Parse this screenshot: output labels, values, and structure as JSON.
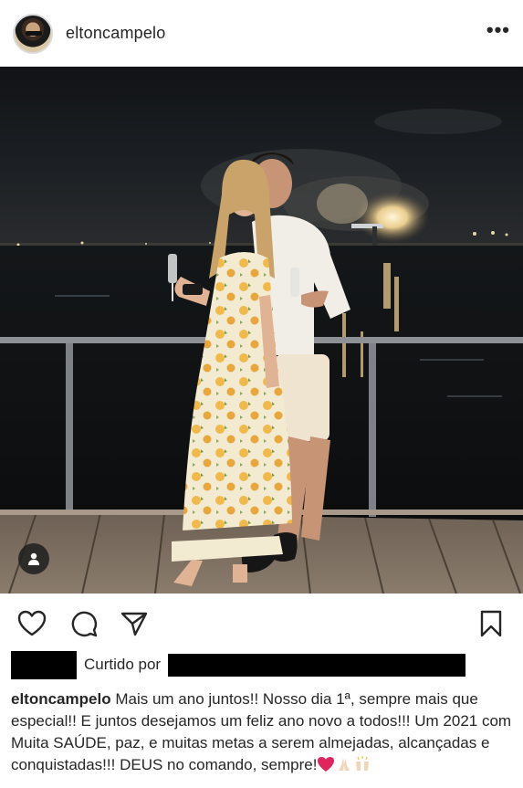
{
  "post": {
    "username": "eltoncampelo",
    "more_label": "•••"
  },
  "likes": {
    "label": "Curtido por"
  },
  "caption": {
    "username": "eltoncampelo",
    "text": "Mais um ano juntos!! Nosso dia 1ª, sempre mais que especial!! E juntos desejamos um feliz ano novo a todos!!! Um 2021 com Muita SAÚDE, paz, e muitas metas a serem almejadas, alcançadas e conquistadas!!! DEUS no comando, sempre!",
    "emojis": [
      "red-heart",
      "folded-hands",
      "raising-hands"
    ]
  },
  "icons": {
    "like": "heart-outline-icon",
    "comment": "comment-bubble-icon",
    "share": "paper-plane-icon",
    "save": "bookmark-icon",
    "tag": "person-tag-icon"
  },
  "colors": {
    "text": "#262626",
    "heart": "#e0245e",
    "redaction": "#000000"
  }
}
